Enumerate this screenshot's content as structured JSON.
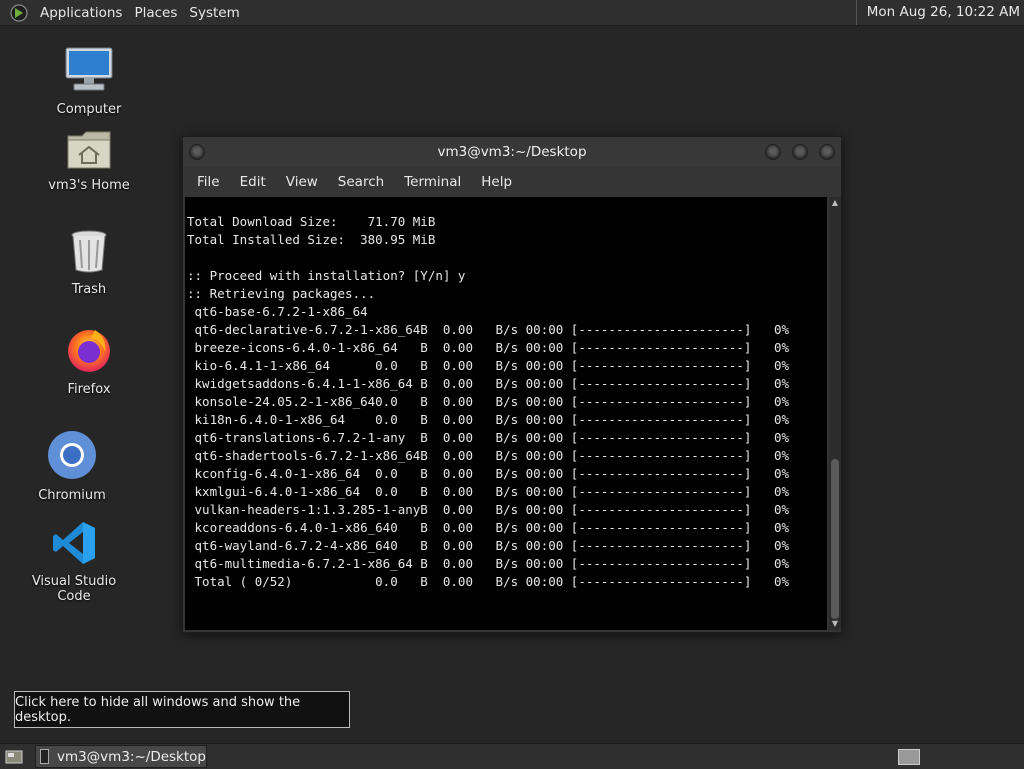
{
  "top_panel": {
    "menus": [
      "Applications",
      "Places",
      "System"
    ],
    "clock": "Mon Aug 26, 10:22 AM"
  },
  "desktop_icons": [
    {
      "label": "Computer",
      "icon": "computer-icon"
    },
    {
      "label": "vm3's Home",
      "icon": "home-folder-icon"
    },
    {
      "label": "Trash",
      "icon": "trash-icon"
    },
    {
      "label": "Firefox",
      "icon": "firefox-icon"
    },
    {
      "label": "Chromium",
      "icon": "chromium-icon"
    },
    {
      "label": "Visual Studio Code",
      "icon": "vscode-icon"
    }
  ],
  "terminal": {
    "title": "vm3@vm3:~/Desktop",
    "menu": [
      "File",
      "Edit",
      "View",
      "Search",
      "Terminal",
      "Help"
    ],
    "lines": [
      "Total Download Size:    71.70 MiB",
      "Total Installed Size:  380.95 MiB",
      "",
      ":: Proceed with installation? [Y/n] y",
      ":: Retrieving packages...",
      " qt6-base-6.7.2-1-x86_64",
      " qt6-declarative-6.7.2-1-x86_64B  0.00   B/s 00:00 [----------------------]   0%",
      " breeze-icons-6.4.0-1-x86_64   B  0.00   B/s 00:00 [----------------------]   0%",
      " kio-6.4.1-1-x86_64      0.0   B  0.00   B/s 00:00 [----------------------]   0%",
      " kwidgetsaddons-6.4.1-1-x86_64 B  0.00   B/s 00:00 [----------------------]   0%",
      " konsole-24.05.2-1-x86_640.0   B  0.00   B/s 00:00 [----------------------]   0%",
      " ki18n-6.4.0-1-x86_64    0.0   B  0.00   B/s 00:00 [----------------------]   0%",
      " qt6-translations-6.7.2-1-any  B  0.00   B/s 00:00 [----------------------]   0%",
      " qt6-shadertools-6.7.2-1-x86_64B  0.00   B/s 00:00 [----------------------]   0%",
      " kconfig-6.4.0-1-x86_64  0.0   B  0.00   B/s 00:00 [----------------------]   0%",
      " kxmlgui-6.4.0-1-x86_64  0.0   B  0.00   B/s 00:00 [----------------------]   0%",
      " vulkan-headers-1:1.3.285-1-anyB  0.00   B/s 00:00 [----------------------]   0%",
      " kcoreaddons-6.4.0-1-x86_640   B  0.00   B/s 00:00 [----------------------]   0%",
      " qt6-wayland-6.7.2-4-x86_640   B  0.00   B/s 00:00 [----------------------]   0%",
      " qt6-multimedia-6.7.2-1-x86_64 B  0.00   B/s 00:00 [----------------------]   0%",
      " Total ( 0/52)           0.0   B  0.00   B/s 00:00 [----------------------]   0%"
    ]
  },
  "tooltip": "Click here to hide all windows and show the desktop.",
  "taskbar": {
    "window_label": "vm3@vm3:~/Desktop"
  }
}
